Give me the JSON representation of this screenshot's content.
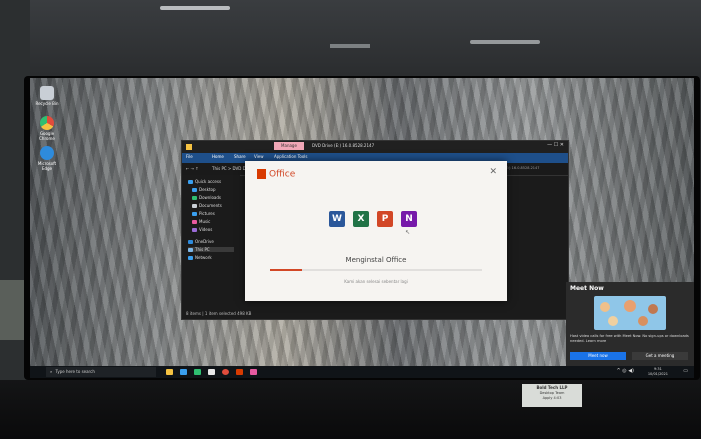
{
  "desktop": {
    "icons": [
      {
        "label": "Recycle Bin",
        "color": "#c9cfd6"
      },
      {
        "label": "Google Chrome",
        "color": "#e14c3c"
      },
      {
        "label": "Microsoft Edge",
        "color": "#2e8bdc"
      }
    ]
  },
  "explorer": {
    "title": "DVD Drive (E:) 16.0.8528.2147",
    "title_tab": "Manage",
    "ribbon_tabs": [
      "File",
      "Home",
      "Share",
      "View",
      "Application Tools"
    ],
    "address": "This PC > DVD Drive (E:) 16.0.8528.2147",
    "search_placeholder": "Search DVD Drive (E:) 16.0.8528.2147",
    "nav": [
      "Quick access",
      "Desktop",
      "Downloads",
      "Documents",
      "Pictures",
      "Music",
      "Videos",
      "OneDrive",
      "This PC",
      "Network"
    ],
    "status": "8 items | 1 item selected  498 KB"
  },
  "office": {
    "brand": "Office",
    "close": "✕",
    "apps": [
      {
        "letter": "W",
        "color": "#2b579a"
      },
      {
        "letter": "X",
        "color": "#217346"
      },
      {
        "letter": "P",
        "color": "#d24726"
      },
      {
        "letter": "N",
        "color": "#7719aa"
      }
    ],
    "status": "Menginstal Office",
    "subtext": "Kami akan selesai sebentar lagi",
    "progress": 0.15
  },
  "meetnow": {
    "title": "Meet Now",
    "description": "Host video calls for free with Meet Now. No sign-ups or downloads needed.  Learn more",
    "meet_button": "Meet now",
    "schedule_button": "Get a meeting"
  },
  "taskbar": {
    "search_placeholder": "Type here to search",
    "time": "9:31",
    "date": "10/01/2021",
    "icon_colors": [
      "#f5c242",
      "#3aa0f0",
      "#2fbf71",
      "#e8e8e8",
      "#e14c3c",
      "#d83b01",
      "#e85aa0"
    ]
  },
  "sticker": {
    "line1": "Bold Tech LLP",
    "line2": "Desktop Team",
    "line3": "Apply 4:03"
  }
}
